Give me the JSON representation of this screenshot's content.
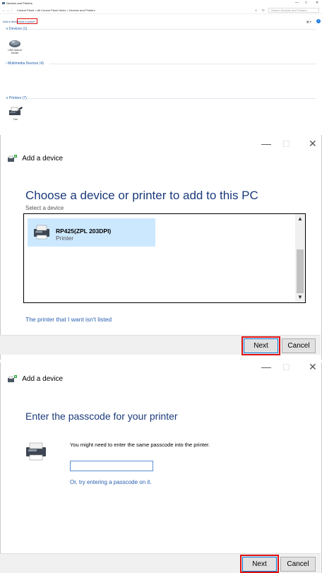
{
  "control_panel": {
    "window_title": "Devices and Printers",
    "window_controls": {
      "minimize": "—",
      "maximize": "□",
      "close": "✕"
    },
    "nav": {
      "back": "←",
      "forward": "→",
      "up": "↑"
    },
    "breadcrumb": "Control Panel  >  All Control Panel Items  >  Devices and Printers",
    "address_dropdown": "∨",
    "refresh": "↻",
    "search_placeholder": "Search Devices and Printers",
    "commands": {
      "add_device": "Add a device",
      "add_printer": "Add a printer"
    },
    "view_icon": "▦ ▾",
    "help": "?",
    "groups": [
      {
        "label": "∨ Devices (1)",
        "items": [
          {
            "label": "USB Optical Mouse",
            "icon": "mouse-icon"
          }
        ]
      },
      {
        "label": "› Multimedia Devices (4)",
        "items": []
      },
      {
        "label": "∨ Printers (7)",
        "items": [
          {
            "label": "Fax",
            "icon": "fax-icon"
          }
        ]
      }
    ]
  },
  "dialog_choose": {
    "window_controls": {
      "minimize": "—",
      "maximize": "□",
      "close": "✕"
    },
    "header": "Add a device",
    "title": "Choose a device or printer to add to this PC",
    "subtitle": "Select a device",
    "devices": [
      {
        "name": "RP425(ZPL 203DPI)",
        "type": "Printer",
        "selected": true
      }
    ],
    "scroll_up": "▲",
    "scroll_down": "▼",
    "link": "The printer that I want isn't listed",
    "next_label": "Next",
    "cancel_label": "Cancel"
  },
  "dialog_passcode": {
    "window_controls": {
      "minimize": "—",
      "maximize": "□",
      "close": "✕"
    },
    "header": "Add a device",
    "title": "Enter the passcode for your printer",
    "message": "You might need to enter the same passcode into the printer.",
    "passcode_value": "",
    "link": "Or, try entering a passcode on it.",
    "next_label": "Next",
    "cancel_label": "Cancel"
  },
  "colors": {
    "accent": "#0078d7",
    "highlight": "#d11111",
    "selection": "#cce8ff",
    "link": "#2a5fb0",
    "heading": "#1a3a7a"
  }
}
